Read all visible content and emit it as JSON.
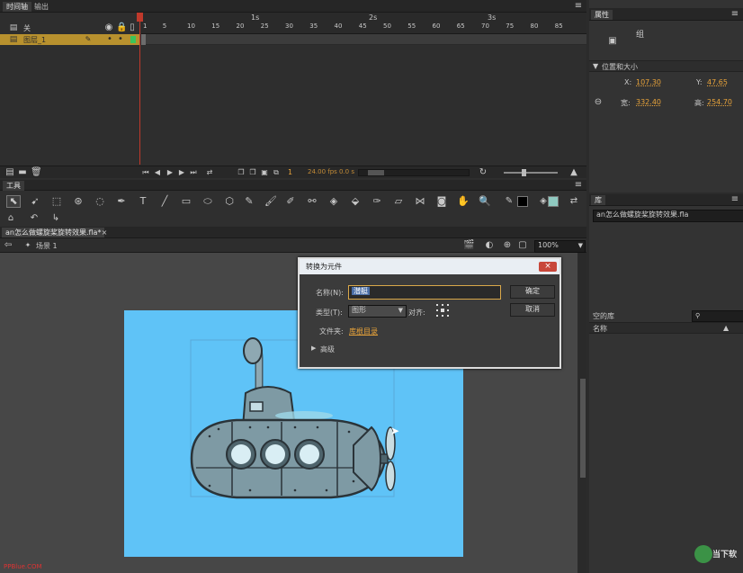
{
  "timeline": {
    "tabs": [
      "时间轴",
      "输出"
    ],
    "layer_group": "关",
    "layer_name": "图层_1",
    "seconds": [
      "1s",
      "2s",
      "3s"
    ],
    "frames": [
      "1",
      "5",
      "10",
      "15",
      "20",
      "25",
      "30",
      "35",
      "40",
      "45",
      "50",
      "55",
      "60",
      "65",
      "70",
      "75",
      "80",
      "85"
    ],
    "frame_readout": "1",
    "fps": "24.00 fps",
    "time": "0.0 s"
  },
  "tools": {
    "title": "工具"
  },
  "document": {
    "tab": "an怎么做螺旋桨旋转效果.fla*",
    "scene": "场景 1",
    "zoom": "100%"
  },
  "properties": {
    "tab": "属性",
    "type": "组",
    "section": "位置和大小",
    "x_label": "X:",
    "x": "107.30",
    "y_label": "Y:",
    "y": "47.65",
    "w_label": "宽:",
    "w": "332.40",
    "h_label": "高:",
    "h": "254.70"
  },
  "library": {
    "tab": "库",
    "doc": "an怎么做螺旋桨旋转效果.fla",
    "count": "空的库",
    "col_name": "名称"
  },
  "dialog": {
    "title": "转换为元件",
    "name_label": "名称(N):",
    "name_value": "潜艇",
    "type_label": "类型(T):",
    "type_value": "图形",
    "align_label": "对齐:",
    "folder_label": "文件夹:",
    "folder_value": "库根目录",
    "advanced": "高级",
    "ok": "确定",
    "cancel": "取消"
  },
  "footer": {
    "watermark": "PPBlue.COM"
  },
  "brand": {
    "logo_text": "当下软"
  },
  "colors": {
    "accent": "#e8a33a",
    "layer_bar": "#b8912e",
    "playhead": "#c0392b",
    "stage_bg": "#5fc3f7",
    "selection": "#59a9d8"
  }
}
